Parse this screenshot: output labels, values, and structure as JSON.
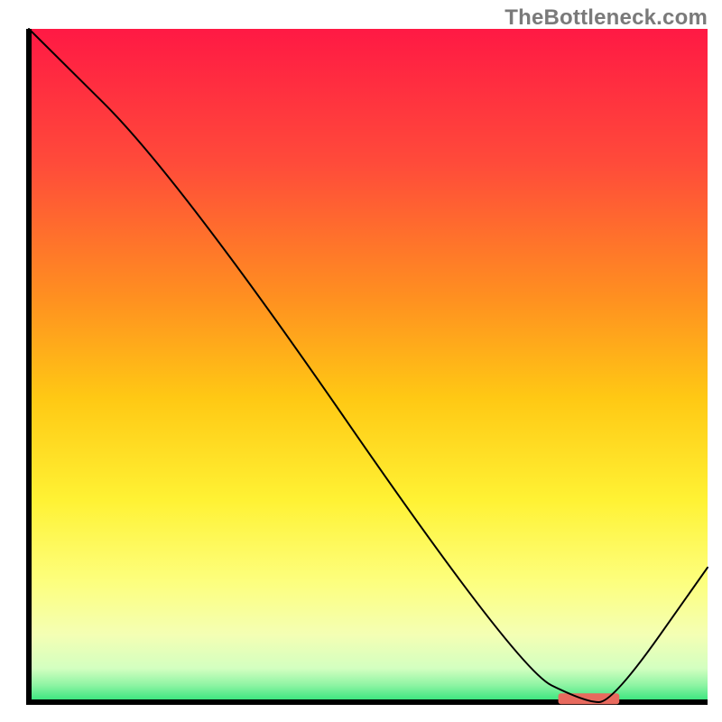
{
  "watermark": "TheBottleneck.com",
  "chart_data": {
    "type": "line",
    "title": "",
    "xlabel": "",
    "ylabel": "",
    "xlim": [
      0,
      100
    ],
    "ylim": [
      0,
      100
    ],
    "grid": false,
    "legend": false,
    "line_color": "#000000",
    "line_width": 2,
    "gradient_stops": [
      {
        "offset": 0.0,
        "color": "#ff1944"
      },
      {
        "offset": 0.2,
        "color": "#ff4b3a"
      },
      {
        "offset": 0.4,
        "color": "#ff9020"
      },
      {
        "offset": 0.55,
        "color": "#ffc914"
      },
      {
        "offset": 0.7,
        "color": "#fff234"
      },
      {
        "offset": 0.82,
        "color": "#fdff7d"
      },
      {
        "offset": 0.9,
        "color": "#f4ffb4"
      },
      {
        "offset": 0.95,
        "color": "#d3ffc0"
      },
      {
        "offset": 0.975,
        "color": "#8df4a3"
      },
      {
        "offset": 1.0,
        "color": "#2fe37a"
      }
    ],
    "series": [
      {
        "name": "bottleneck-curve",
        "x": [
          0,
          22,
          72,
          82,
          86,
          100
        ],
        "y": [
          100,
          78,
          5,
          0,
          0,
          20
        ]
      }
    ],
    "marker": {
      "name": "optimal-range",
      "color": "#e86a5e",
      "x_start": 78,
      "x_end": 87,
      "y": 0.5,
      "height": 1.6
    }
  }
}
